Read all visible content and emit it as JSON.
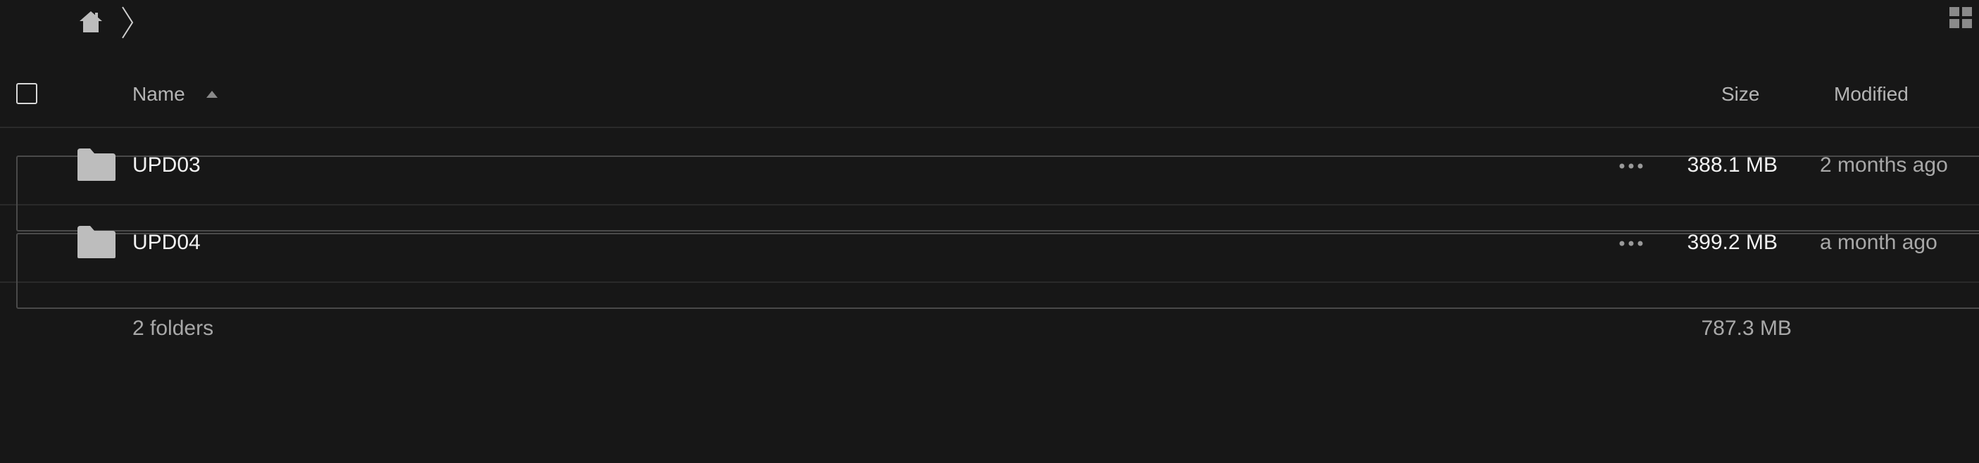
{
  "breadcrumb": {
    "home_icon": "home-icon",
    "separator_icon": "chevron-right-icon"
  },
  "view_toggle_icon": "grid-view-icon",
  "table": {
    "columns": {
      "name": "Name",
      "size": "Size",
      "modified": "Modified"
    },
    "sort": {
      "column": "name",
      "direction": "ascending"
    },
    "rows": [
      {
        "name": "UPD03",
        "size": "388.1 MB",
        "modified": "2 months ago",
        "icon": "folder-icon"
      },
      {
        "name": "UPD04",
        "size": "399.2 MB",
        "modified": "a month ago",
        "icon": "folder-icon"
      }
    ],
    "summary": {
      "count": "2 folders",
      "total_size": "787.3 MB"
    }
  },
  "colors": {
    "background": "#171717",
    "text_primary": "#f2f2f2",
    "text_secondary": "#a8a8a8",
    "divider": "#2a2a2a",
    "icon": "#bdbdbd"
  }
}
